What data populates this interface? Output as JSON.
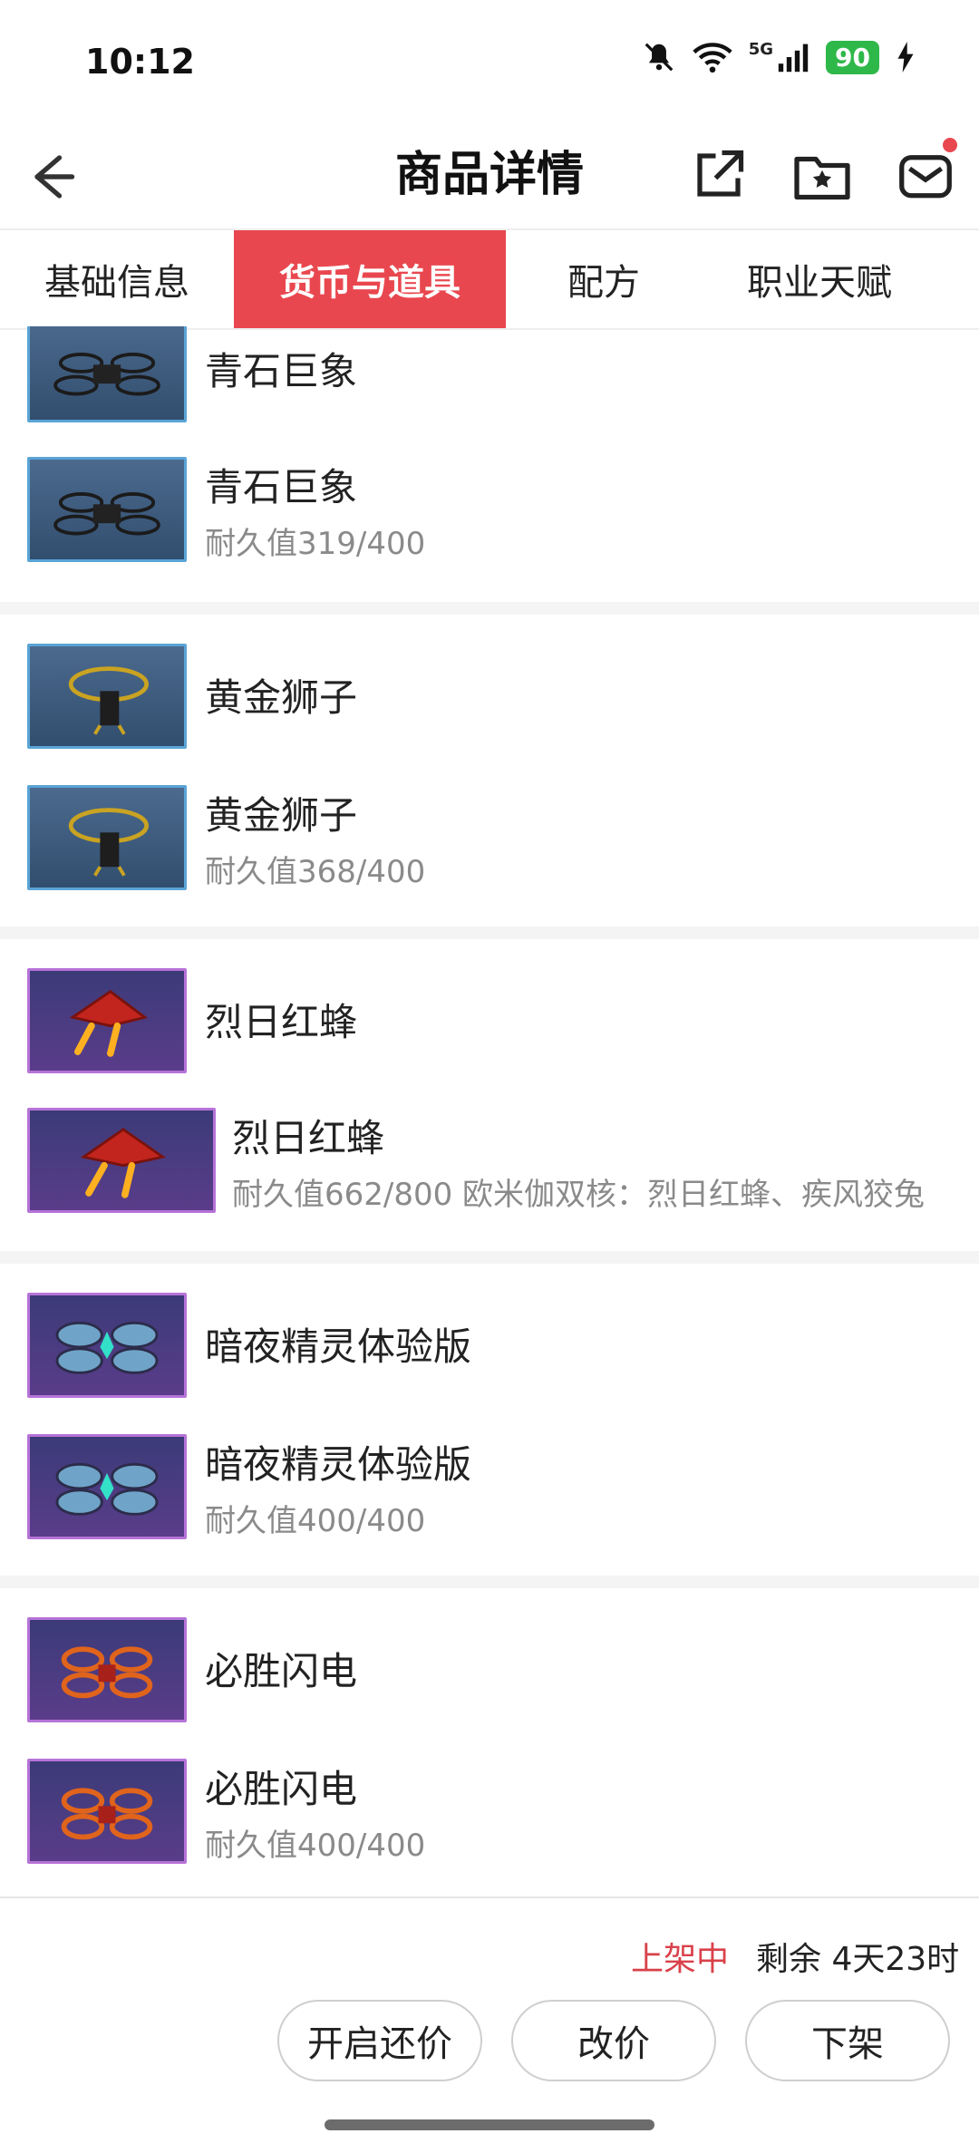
{
  "status_bar": {
    "time": "10:12",
    "network": "5G",
    "battery": "90"
  },
  "header": {
    "title": "商品详情"
  },
  "tabs": [
    {
      "label": "基础信息"
    },
    {
      "label": "货币与道具"
    },
    {
      "label": "配方"
    },
    {
      "label": "职业天赋"
    }
  ],
  "items": [
    {
      "name": "青石巨象",
      "durability": ""
    },
    {
      "name": "青石巨象",
      "durability": "耐久值319/400"
    },
    {
      "name": "黄金狮子",
      "durability": ""
    },
    {
      "name": "黄金狮子",
      "durability": "耐久值368/400"
    },
    {
      "name": "烈日红蜂",
      "durability": ""
    },
    {
      "name": "烈日红蜂",
      "durability": "耐久值662/800   欧米伽双核：烈日红蜂、疾风狡兔"
    },
    {
      "name": "暗夜精灵体验版",
      "durability": ""
    },
    {
      "name": "暗夜精灵体验版",
      "durability": "耐久值400/400"
    },
    {
      "name": "必胜闪电",
      "durability": ""
    },
    {
      "name": "必胜闪电",
      "durability": "耐久值400/400"
    }
  ],
  "footer": {
    "status": "上架中",
    "remaining": "剩余 4天23时",
    "buttons": {
      "counter_offer": "开启还价",
      "change_price": "改价",
      "delist": "下架"
    }
  },
  "colors": {
    "accent": "#e9474f",
    "blue_frame": "#5aa4d6",
    "purple_frame": "#b673d8"
  }
}
